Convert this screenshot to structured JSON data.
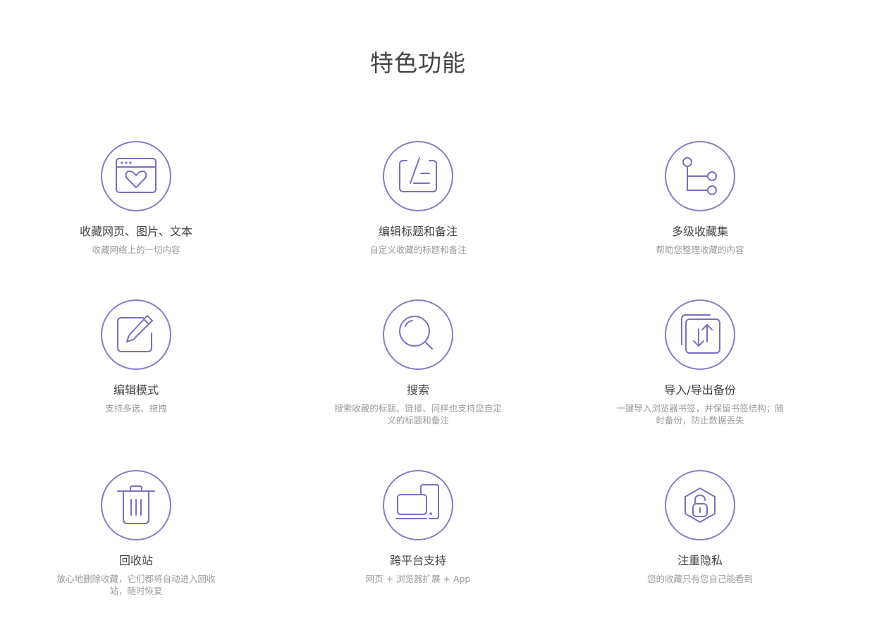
{
  "page": {
    "title": "特色功能"
  },
  "colors": {
    "accent": "#8a7cc6",
    "title_text": "#444444",
    "desc_text": "#9a9a9a"
  },
  "features": [
    {
      "icon": "browser-heart-icon",
      "title": "收藏网页、图片、文本",
      "desc": "收藏网络上的一切内容"
    },
    {
      "icon": "edit-note-icon",
      "title": "编辑标题和备注",
      "desc": "自定义收藏的标题和备注"
    },
    {
      "icon": "tree-hierarchy-icon",
      "title": "多级收藏集",
      "desc": "帮助您整理收藏的内容"
    },
    {
      "icon": "pencil-icon",
      "title": "编辑模式",
      "desc": "支持多选、拖拽"
    },
    {
      "icon": "search-icon",
      "title": "搜索",
      "desc": "搜索收藏的标题、链接、同样也支持您自定义的标题和备注"
    },
    {
      "icon": "import-export-icon",
      "title": "导入/导出备份",
      "desc": "一键导入浏览器书签，并保留书签结构；随时备份，防止数据丢失"
    },
    {
      "icon": "trash-icon",
      "title": "回收站",
      "desc": "放心地删除收藏，它们都将自动进入回收站，随时恢复"
    },
    {
      "icon": "devices-icon",
      "title": "跨平台支持",
      "desc": "网页 + 浏览器扩展 + App"
    },
    {
      "icon": "lock-icon",
      "title": "注重隐私",
      "desc": "您的收藏只有您自己能看到"
    }
  ]
}
